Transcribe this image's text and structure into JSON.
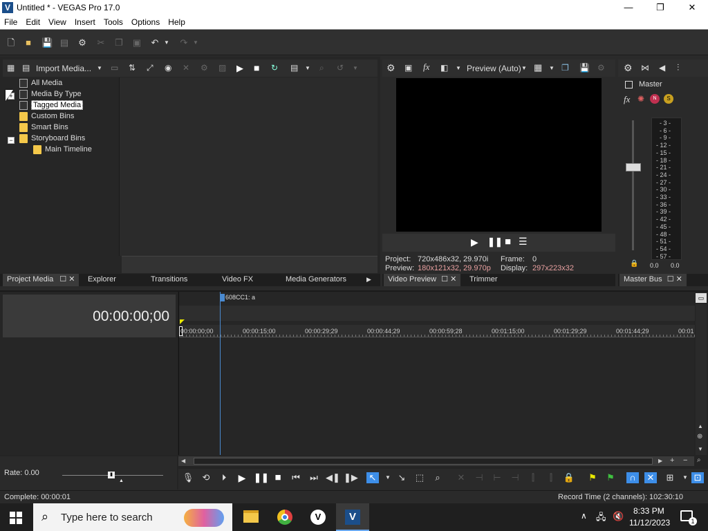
{
  "window": {
    "title": "Untitled * - VEGAS Pro 17.0",
    "minimize": "—",
    "maximize": "❐",
    "close": "✕"
  },
  "menu": [
    "File",
    "Edit",
    "View",
    "Insert",
    "Tools",
    "Options",
    "Help"
  ],
  "project_media": {
    "import_label": "Import Media...",
    "tree": [
      {
        "label": "All Media",
        "indent": 0,
        "icon": "media",
        "toggle": ""
      },
      {
        "label": "Media By Type",
        "indent": 0,
        "icon": "media",
        "toggle": "+"
      },
      {
        "label": "Tagged Media",
        "indent": 0,
        "icon": "media",
        "toggle": "",
        "selected": true
      },
      {
        "label": "Custom Bins",
        "indent": 0,
        "icon": "folder",
        "toggle": ""
      },
      {
        "label": "Smart Bins",
        "indent": 0,
        "icon": "folder",
        "toggle": ""
      },
      {
        "label": "Storyboard Bins",
        "indent": 0,
        "icon": "folder",
        "toggle": "−"
      },
      {
        "label": "Main Timeline",
        "indent": 1,
        "icon": "folder",
        "toggle": ""
      }
    ]
  },
  "left_tabs": [
    "Project Media",
    "Explorer",
    "Transitions",
    "Video FX",
    "Media Generators"
  ],
  "preview": {
    "mode": "Preview (Auto)",
    "project_label": "Project:",
    "project_value": "720x486x32, 29.970i",
    "preview_label": "Preview:",
    "preview_value": "180x121x32, 29.970p",
    "frame_label": "Frame:",
    "frame_value": "0",
    "display_label": "Display:",
    "display_value": "297x223x32",
    "tabs": [
      "Video Preview",
      "Trimmer"
    ]
  },
  "master": {
    "label": "Master",
    "scale": [
      "3",
      "6",
      "9",
      "12",
      "15",
      "18",
      "21",
      "24",
      "27",
      "30",
      "33",
      "36",
      "39",
      "42",
      "45",
      "48",
      "51",
      "54",
      "57"
    ],
    "left_value": "0.0",
    "right_value": "0.0",
    "tab": "Master Bus"
  },
  "timeline": {
    "timecode": "00:00:00;00",
    "marker_label": "608CC1: a",
    "ruler": [
      "00:00:00;00",
      "00:00:15;00",
      "00:00:29;29",
      "00:00:44;29",
      "00:00:59;28",
      "00:01:15;00",
      "00:01:29;29",
      "00:01:44;29",
      "00:01"
    ],
    "rate_label": "Rate: 0.00"
  },
  "status": {
    "left": "Complete: 00:00:01",
    "right": "Record Time (2 channels): 102:30:10"
  },
  "taskbar": {
    "search_placeholder": "Type here to search",
    "time": "8:33 PM",
    "date": "11/12/2023",
    "notification_count": "1"
  },
  "colors": {
    "accent": "#3d8ee8",
    "info_highlight": "#e8a0a0"
  }
}
